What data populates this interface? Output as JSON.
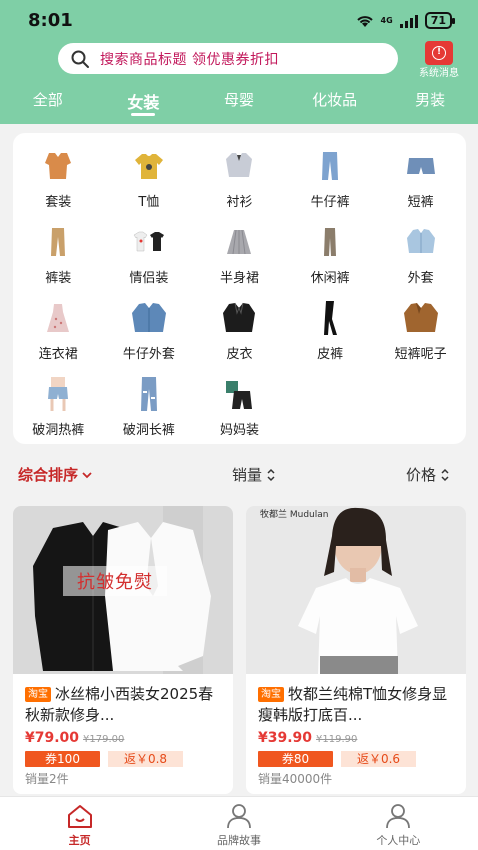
{
  "status": {
    "time": "8:01",
    "battery": "71",
    "network": "4G"
  },
  "search": {
    "placeholder": "搜索商品标题 领优惠券折扣"
  },
  "message": {
    "label": "系统消息"
  },
  "tabs": [
    {
      "label": "全部"
    },
    {
      "label": "女装"
    },
    {
      "label": "母婴"
    },
    {
      "label": "化妆品"
    },
    {
      "label": "男装"
    }
  ],
  "active_tab": "女装",
  "categories": [
    {
      "label": "套装"
    },
    {
      "label": "T恤"
    },
    {
      "label": "衬衫"
    },
    {
      "label": "牛仔裤"
    },
    {
      "label": "短裤"
    },
    {
      "label": "裤装"
    },
    {
      "label": "情侣装"
    },
    {
      "label": "半身裙"
    },
    {
      "label": "休闲裤"
    },
    {
      "label": "外套"
    },
    {
      "label": "连衣裙"
    },
    {
      "label": "牛仔外套"
    },
    {
      "label": "皮衣"
    },
    {
      "label": "皮裤"
    },
    {
      "label": "短裤呢子"
    },
    {
      "label": "破洞热裤"
    },
    {
      "label": "破洞长裤"
    },
    {
      "label": "妈妈装"
    }
  ],
  "sort": {
    "main": "综合排序",
    "sales": "销量",
    "price": "价格"
  },
  "products": [
    {
      "image_text": "抗皱免熨",
      "tag": "淘宝",
      "title": "冰丝棉小西装女2025春秋新款修身...",
      "price": "¥79.00",
      "old_price": "¥179.00",
      "coupon": "券100",
      "rebate": "返￥0.8",
      "sales": "销量2件"
    },
    {
      "brand_mark": "牧都兰 Mudulan",
      "tag": "淘宝",
      "title": "牧都兰纯棉T恤女修身显瘦韩版打底百...",
      "price": "¥39.90",
      "old_price": "¥119.90",
      "coupon": "券80",
      "rebate": "返￥0.6",
      "sales": "销量40000件"
    }
  ],
  "bottom_nav": [
    {
      "label": "主页"
    },
    {
      "label": "品牌故事"
    },
    {
      "label": "个人中心"
    }
  ],
  "colors": {
    "header": "#7fcfa6",
    "accent": "#c62828",
    "coupon": "#f0571f",
    "tag": "#ff6f00"
  }
}
